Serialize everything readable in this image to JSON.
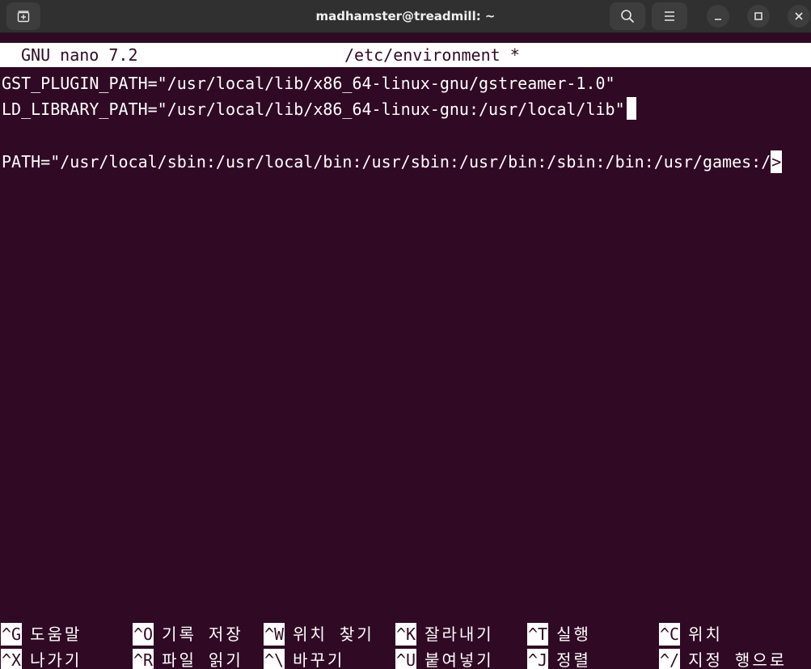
{
  "window": {
    "title": "madhamster@treadmill: ~"
  },
  "nano": {
    "version": "GNU nano 7.2",
    "filename": "/etc/environment *"
  },
  "buffer": {
    "lines": [
      "GST_PLUGIN_PATH=\"/usr/local/lib/x86_64-linux-gnu/gstreamer-1.0\"",
      "LD_LIBRARY_PATH=\"/usr/local/lib/x86_64-linux-gnu:/usr/local/lib\"",
      "",
      "PATH=\"/usr/local/sbin:/usr/local/bin:/usr/sbin:/usr/bin:/sbin:/bin:/usr/games:/"
    ],
    "overflow_marker": ">"
  },
  "shortcuts": {
    "row1": [
      {
        "key": "^G",
        "label": "도움말"
      },
      {
        "key": "^O",
        "label": "기록 저장"
      },
      {
        "key": "^W",
        "label": "위치 찾기"
      },
      {
        "key": "^K",
        "label": "잘라내기"
      },
      {
        "key": "^T",
        "label": "실행"
      },
      {
        "key": "^C",
        "label": "위치"
      }
    ],
    "row2": [
      {
        "key": "^X",
        "label": "나가기"
      },
      {
        "key": "^R",
        "label": "파일 읽기"
      },
      {
        "key": "^\\",
        "label": "바꾸기"
      },
      {
        "key": "^U",
        "label": "붙여넣기"
      },
      {
        "key": "^J",
        "label": "정렬"
      },
      {
        "key": "^/",
        "label": "지정 행으로"
      }
    ]
  },
  "colors": {
    "terminal_bg": "#300a24",
    "titlebar_bg": "#303030",
    "text": "#ffffff"
  },
  "icons": {
    "new_tab": "new-tab-icon",
    "search": "search-icon",
    "menu": "hamburger-menu-icon",
    "minimize": "minimize-icon",
    "maximize": "maximize-icon",
    "close": "close-icon"
  }
}
